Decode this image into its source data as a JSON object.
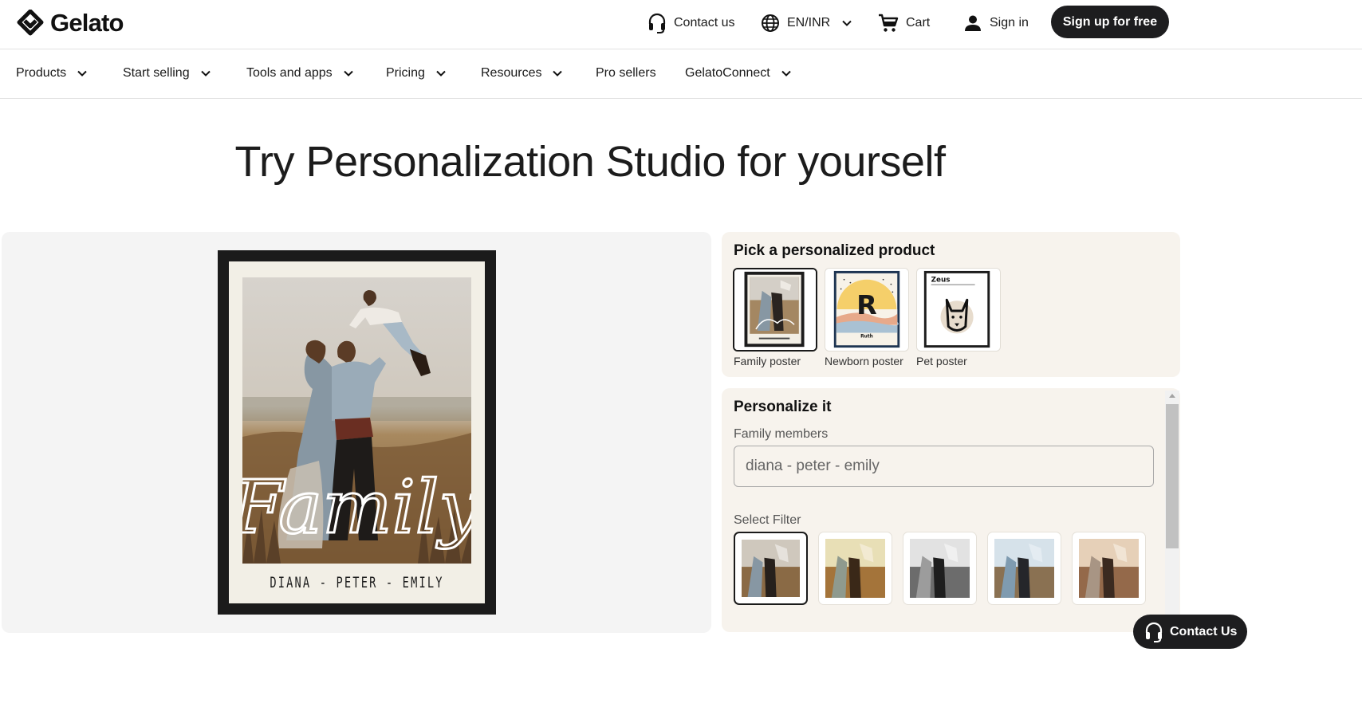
{
  "header": {
    "brand": "Gelato",
    "contact_label": "Contact us",
    "locale_label": "EN/INR",
    "cart_label": "Cart",
    "signin_label": "Sign in",
    "signup_label": "Sign up for free"
  },
  "nav": {
    "items": [
      {
        "label": "Products",
        "dropdown": true
      },
      {
        "label": "Start selling",
        "dropdown": true
      },
      {
        "label": "Tools and apps",
        "dropdown": true
      },
      {
        "label": "Pricing",
        "dropdown": true
      },
      {
        "label": "Resources",
        "dropdown": true
      },
      {
        "label": "Pro sellers",
        "dropdown": false
      },
      {
        "label": "GelatoConnect",
        "dropdown": true
      }
    ]
  },
  "hero": {
    "title": "Try Personalization Studio for yourself"
  },
  "preview": {
    "poster_script": "Family",
    "poster_names": "DIANA - PETER - EMILY"
  },
  "product_picker": {
    "title": "Pick a personalized product",
    "products": [
      {
        "label": "Family poster",
        "selected": true
      },
      {
        "label": "Newborn poster",
        "selected": false,
        "thumb_letter": "R",
        "thumb_name": "Ruth"
      },
      {
        "label": "Pet poster",
        "selected": false,
        "thumb_name": "Zeus"
      }
    ]
  },
  "personalize": {
    "title": "Personalize it",
    "members_label": "Family members",
    "members_value": "diana - peter - emily",
    "filter_label": "Select Filter",
    "filters": [
      {
        "name": "original",
        "selected": true
      },
      {
        "name": "warm",
        "selected": false
      },
      {
        "name": "black-and-white",
        "selected": false
      },
      {
        "name": "cool",
        "selected": false
      },
      {
        "name": "sepia",
        "selected": false
      }
    ]
  },
  "floating": {
    "contact_label": "Contact Us"
  },
  "colors": {
    "dark_button": "#1d1d1f",
    "panel_beige": "#f7f3ed",
    "preview_gray": "#f4f4f4",
    "poster_mat": "#f2efe6"
  }
}
